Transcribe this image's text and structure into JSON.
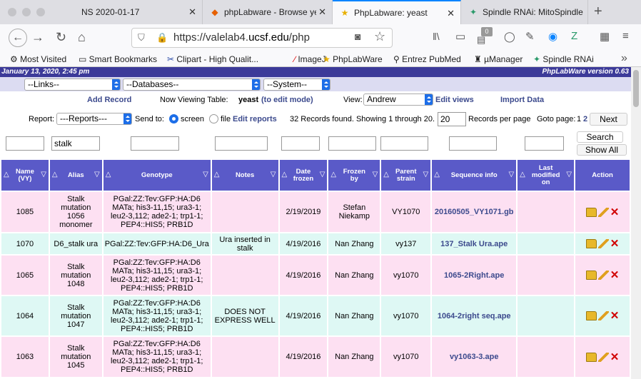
{
  "browser": {
    "tabs": [
      {
        "label": "NS 2020-01-17",
        "icon": "file-icon"
      },
      {
        "label": "phpLabware - Browse yeast",
        "icon": "firefox-icon"
      },
      {
        "label": "PhpLabware: yeast",
        "icon": "star-icon"
      },
      {
        "label": "Spindle RNAi: MitoSpindle",
        "icon": "spindle-icon"
      }
    ],
    "url_prefix": "https://valelab4.",
    "url_domain": "ucsf.edu",
    "url_suffix": "/php",
    "badge": "0",
    "bookmarks": [
      "Most Visited",
      "Smart Bookmarks",
      "Clipart - High Qualit...",
      "ImageJ",
      "PhpLabWare",
      "Entrez PubMed",
      "µManager",
      "Spindle RNAi"
    ]
  },
  "page": {
    "date": "January 13, 2020, 2:45 pm",
    "version": "PhpLabWare version 0.63",
    "menus": {
      "links": "--Links--",
      "databases": "--Databases--",
      "system": "--System--"
    },
    "add_record": "Add Record",
    "viewing_prefix": "Now Viewing Table:",
    "viewing_table": "yeast",
    "edit_mode": "(to edit mode)",
    "view_label": "View:",
    "view_value": "Andrew",
    "edit_views": "Edit views",
    "import_data": "Import Data",
    "report_label": "Report:",
    "report_value": "---Reports---",
    "send_to": "Send to:",
    "screen": "screen",
    "file": "file",
    "edit_reports": "Edit reports",
    "records_found": "32 Records found. Showing 1 through 20.",
    "per_page_value": "20",
    "per_page_label": "Records per page",
    "goto_page": "Goto page:",
    "page_1": "1",
    "page_2": "2",
    "next": "Next",
    "search": "Search",
    "show_all": "Show All",
    "alias_filter": "stalk"
  },
  "table": {
    "headers": [
      "Name (VY)",
      "Alias",
      "Genotype",
      "Notes",
      "Date frozen",
      "Frozen by",
      "Parent strain",
      "Sequence info",
      "Last modified on",
      "Action"
    ],
    "rows": [
      {
        "name": "1085",
        "alias": "Stalk mutation 1056 monomer",
        "genotype": "PGal:ZZ:Tev:GFP:HA:D6 MATa; his3-11,15; ura3-1; leu2-3,112; ade2-1; trp1-1; PEP4::HIS5; PRB1D",
        "notes": "",
        "date": "2/19/2019",
        "frozen_by": "Stefan Niekamp",
        "parent": "VY1070",
        "seq": "20160505_VY1071.gb",
        "modified": ""
      },
      {
        "name": "1070",
        "alias": "D6_stalk ura",
        "genotype": "PGal:ZZ:Tev:GFP:HA:D6_Ura",
        "notes": "Ura inserted in stalk",
        "date": "4/19/2016",
        "frozen_by": "Nan Zhang",
        "parent": "vy137",
        "seq": "137_Stalk Ura.ape",
        "modified": ""
      },
      {
        "name": "1065",
        "alias": "Stalk mutation 1048",
        "genotype": "PGal:ZZ:Tev:GFP:HA:D6 MATa; his3-11,15; ura3-1; leu2-3,112; ade2-1; trp1-1; PEP4::HIS5; PRB1D",
        "notes": "",
        "date": "4/19/2016",
        "frozen_by": "Nan Zhang",
        "parent": "vy1070",
        "seq": "1065-2Right.ape",
        "modified": ""
      },
      {
        "name": "1064",
        "alias": "Stalk mutation 1047",
        "genotype": "PGal:ZZ:Tev:GFP:HA:D6 MATa; his3-11,15; ura3-1; leu2-3,112; ade2-1; trp1-1; PEP4::HIS5; PRB1D",
        "notes": "DOES NOT EXPRESS WELL",
        "date": "4/19/2016",
        "frozen_by": "Nan Zhang",
        "parent": "vy1070",
        "seq": "1064-2right seq.ape",
        "modified": ""
      },
      {
        "name": "1063",
        "alias": "Stalk mutation 1045",
        "genotype": "PGal:ZZ:Tev:GFP:HA:D6 MATa; his3-11,15; ura3-1; leu2-3,112; ade2-1; trp1-1; PEP4::HIS5; PRB1D",
        "notes": "",
        "date": "4/19/2016",
        "frozen_by": "Nan Zhang",
        "parent": "vy1070",
        "seq": "vy1063-3.ape",
        "modified": ""
      }
    ]
  },
  "colors": {
    "header": "#3c3a99",
    "table_header": "#5a5ac8",
    "row_pink": "#fde0f2",
    "row_teal": "#def8f4",
    "accent": "#1d6ee8"
  }
}
